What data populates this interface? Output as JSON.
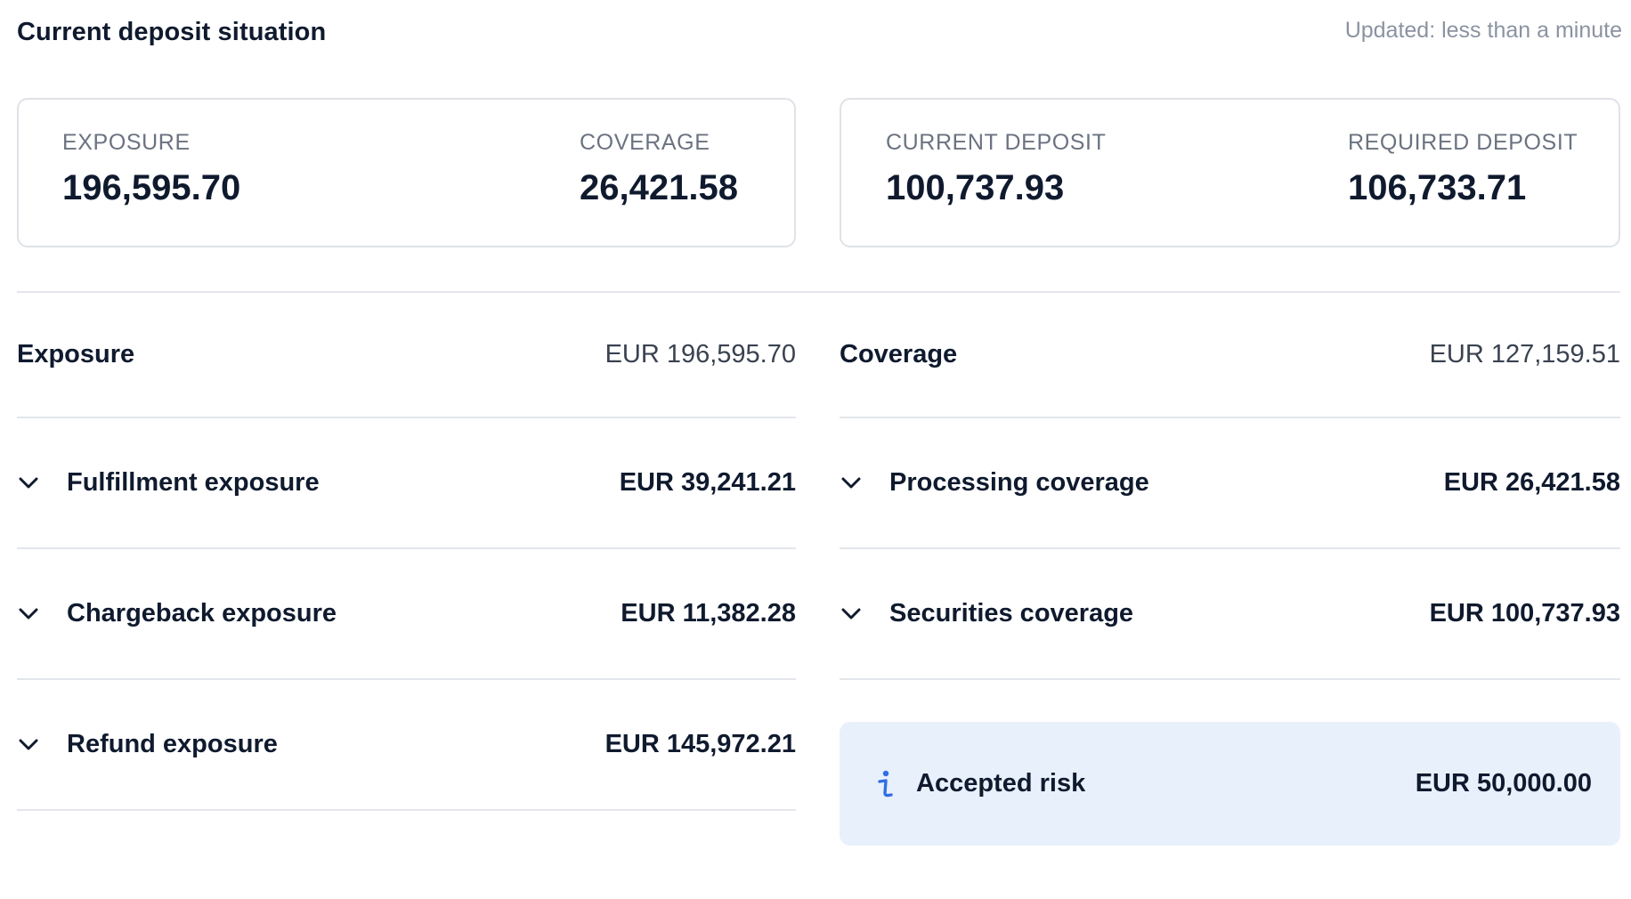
{
  "header": {
    "title": "Current deposit situation",
    "updated": "Updated: less than a minute"
  },
  "summary": {
    "exposure_label": "EXPOSURE",
    "exposure_value": "196,595.70",
    "coverage_label": "COVERAGE",
    "coverage_value": "26,421.58",
    "current_deposit_label": "CURRENT DEPOSIT",
    "current_deposit_value": "100,737.93",
    "required_deposit_label": "REQUIRED DEPOSIT",
    "required_deposit_value": "106,733.71"
  },
  "exposure": {
    "title": "Exposure",
    "total": "EUR 196,595.70",
    "items": [
      {
        "label": "Fulfillment exposure",
        "amount": "EUR 39,241.21"
      },
      {
        "label": "Chargeback exposure",
        "amount": "EUR 11,382.28"
      },
      {
        "label": "Refund exposure",
        "amount": "EUR 145,972.21"
      }
    ]
  },
  "coverage": {
    "title": "Coverage",
    "total": "EUR 127,159.51",
    "items": [
      {
        "label": "Processing coverage",
        "amount": "EUR 26,421.58"
      },
      {
        "label": "Securities coverage",
        "amount": "EUR 100,737.93"
      }
    ],
    "accepted_risk": {
      "label": "Accepted risk",
      "amount": "EUR 50,000.00"
    }
  },
  "icons": {
    "chevron": "chevron-down-icon",
    "info": "info-icon"
  },
  "colors": {
    "text": "#0f1a2e",
    "muted": "#6b7380",
    "border": "#e3e6ea",
    "info_bg": "#e8f0fc",
    "info_icon": "#2f6fe4"
  }
}
